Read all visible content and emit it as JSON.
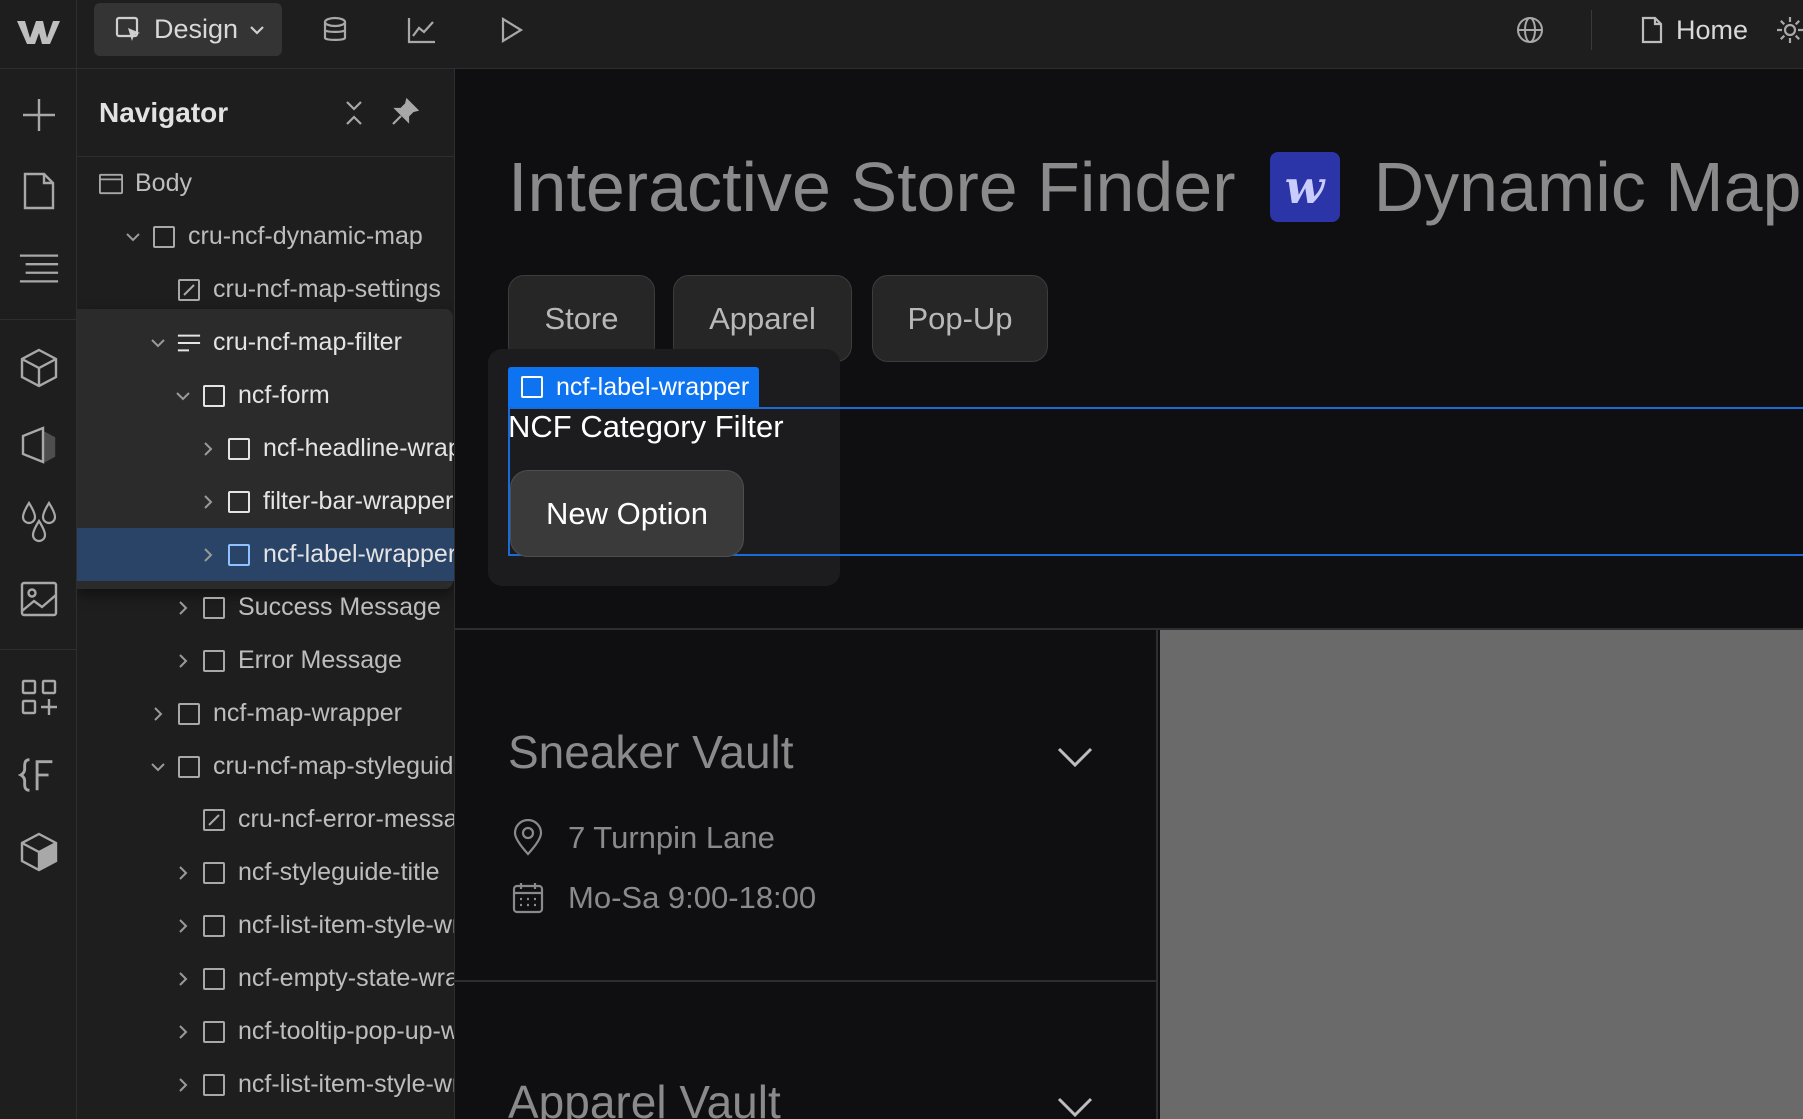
{
  "topbar": {
    "mode_label": "Design",
    "home_label": "Home"
  },
  "navigator": {
    "title": "Navigator",
    "items": [
      {
        "label": "Body",
        "icon": "body-icon",
        "depth": 0,
        "caret": "none"
      },
      {
        "label": "cru-ncf-dynamic-map",
        "icon": "box-icon",
        "depth": 1,
        "caret": "expanded"
      },
      {
        "label": "cru-ncf-map-settings",
        "icon": "embed-icon",
        "depth": 2,
        "caret": "none"
      },
      {
        "label": "cru-ncf-map-filter",
        "icon": "form-icon",
        "depth": 2,
        "caret": "expanded"
      },
      {
        "label": "ncf-form",
        "icon": "box-icon",
        "depth": 3,
        "caret": "expanded"
      },
      {
        "label": "ncf-headline-wrapper",
        "icon": "box-icon",
        "depth": 4,
        "caret": "collapsed"
      },
      {
        "label": "filter-bar-wrapper",
        "icon": "box-icon",
        "depth": 4,
        "caret": "collapsed"
      },
      {
        "label": "ncf-label-wrapper",
        "icon": "box-icon",
        "depth": 4,
        "caret": "collapsed",
        "selected": true
      },
      {
        "label": "Success Message",
        "icon": "box-icon",
        "depth": 3,
        "caret": "collapsed"
      },
      {
        "label": "Error Message",
        "icon": "box-icon",
        "depth": 3,
        "caret": "collapsed"
      },
      {
        "label": "ncf-map-wrapper",
        "icon": "box-icon",
        "depth": 2,
        "caret": "collapsed"
      },
      {
        "label": "cru-ncf-map-styleguide",
        "icon": "box-icon",
        "depth": 2,
        "caret": "expanded"
      },
      {
        "label": "cru-ncf-error-message",
        "icon": "embed-icon",
        "depth": 3,
        "caret": "none"
      },
      {
        "label": "ncf-styleguide-title",
        "icon": "box-icon",
        "depth": 3,
        "caret": "collapsed"
      },
      {
        "label": "ncf-list-item-style-wrapper",
        "icon": "box-icon",
        "depth": 3,
        "caret": "collapsed"
      },
      {
        "label": "ncf-empty-state-wrapper",
        "icon": "box-icon",
        "depth": 3,
        "caret": "collapsed"
      },
      {
        "label": "ncf-tooltip-pop-up-wrapper",
        "icon": "box-icon",
        "depth": 3,
        "caret": "collapsed"
      },
      {
        "label": "ncf-list-item-style-wrapper",
        "icon": "box-icon",
        "depth": 3,
        "caret": "collapsed"
      }
    ]
  },
  "canvas": {
    "title_left": "Interactive Store Finder",
    "badge_letter": "w",
    "title_right": "Dynamic Map",
    "chips": [
      "Store",
      "Apparel",
      "Pop-Up"
    ],
    "selected_element_tag": "ncf-label-wrapper",
    "filter_label": "NCF Category Filter",
    "new_option": "New Option",
    "stores": [
      {
        "name": "Sneaker Vault",
        "address": "7 Turnpin Lane",
        "hours": "Mo-Sa 9:00-18:00"
      },
      {
        "name": "Apparel Vault"
      }
    ]
  },
  "colors": {
    "selection_blue": "#0e73f0",
    "selected_row": "#2a4467",
    "badge": "#2c35a8",
    "map_gray": "#6a6a6a"
  }
}
